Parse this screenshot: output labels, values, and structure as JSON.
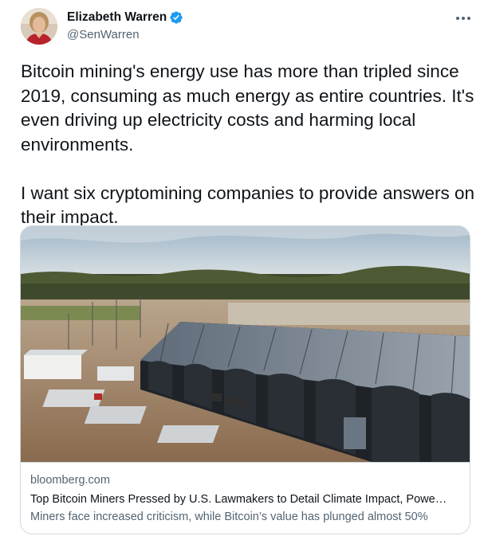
{
  "author": {
    "name": "Elizabeth Warren",
    "handle": "@SenWarren",
    "avatar_icon": "profile-photo",
    "verified_icon": "verified-badge-icon"
  },
  "tweet": {
    "text": "Bitcoin mining's energy use has more than tripled since 2019, consuming as much energy as entire countries. It's even driving up electricity costs and harming local environments.\n\nI want six cryptomining companies to provide answers on their impact."
  },
  "link_card": {
    "domain": "bloomberg.com",
    "title": "Top Bitcoin Miners Pressed by U.S. Lawmakers to Detail Climate Impact, Powe…",
    "description": "Miners face increased criticism, while Bitcoin’s value has plunged almost 50%",
    "image_subject": "aerial-photo-bitcoin-mining-facility"
  },
  "colors": {
    "text_primary": "#0f1419",
    "text_secondary": "#536471",
    "border": "#cfd9de",
    "verified_blue": "#1d9bf0"
  }
}
